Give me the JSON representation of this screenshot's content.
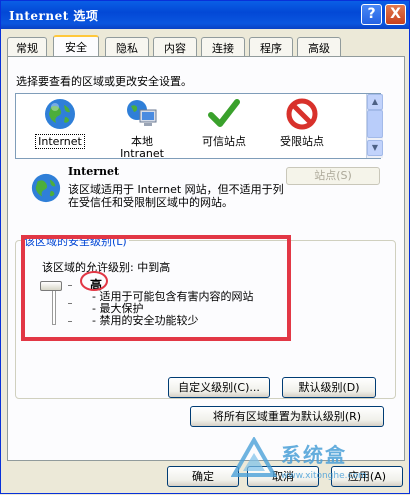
{
  "window": {
    "title": "Internet 选项",
    "help_glyph": "?",
    "close_glyph": "X"
  },
  "tabs": [
    {
      "label": "常规",
      "active": false
    },
    {
      "label": "安全",
      "active": true
    },
    {
      "label": "隐私",
      "active": false
    },
    {
      "label": "内容",
      "active": false
    },
    {
      "label": "连接",
      "active": false
    },
    {
      "label": "程序",
      "active": false
    },
    {
      "label": "高级",
      "active": false
    }
  ],
  "security": {
    "instruction": "选择要查看的区域或更改安全设置。",
    "zones": [
      {
        "label": "Internet",
        "icon": "globe-icon",
        "selected": true
      },
      {
        "label": "本地\nIntranet",
        "icon": "intranet-icon",
        "selected": false
      },
      {
        "label": "可信站点",
        "icon": "checkmark-icon",
        "selected": false
      },
      {
        "label": "受限站点",
        "icon": "no-entry-icon",
        "selected": false
      }
    ],
    "zone_info": {
      "title": "Internet",
      "description": "该区域适用于 Internet 网站，但不适用于列在受信任和受限制区域中的网站。",
      "sites_button": "站点(S)"
    },
    "level_group": {
      "legend": "该区域的安全级别(L)",
      "allowed_levels": "该区域的允许级别: 中到高",
      "level_name": "高",
      "details": [
        "适用于可能包含有害内容的网站",
        "最大保护",
        "禁用的安全功能较少"
      ]
    },
    "custom_level_button": "自定义级别(C)...",
    "default_level_button": "默认级别(D)",
    "reset_all_button": "将所有区域重置为默认级别(R)"
  },
  "footer": {
    "ok": "确定",
    "cancel": "取消",
    "apply": "应用(A)"
  },
  "watermark": {
    "text": "系统盒",
    "url": "www.xitonghe.com"
  },
  "colors": {
    "titlebar": "#0a5fe6",
    "highlight": "#e23745",
    "legend": "#0046d5"
  }
}
